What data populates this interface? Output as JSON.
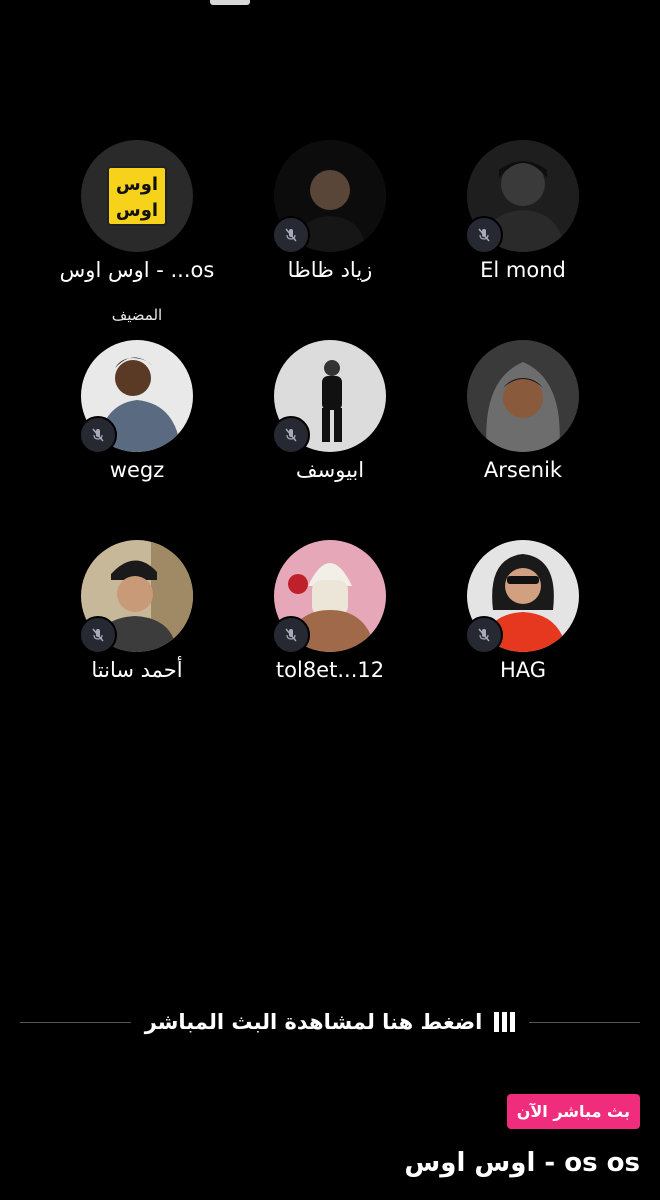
{
  "participants": [
    {
      "name": "اوس اوس - ...os",
      "role": "المضيف",
      "muted": false,
      "avatar": "logo-avatar"
    },
    {
      "name": "زياد ظاظا",
      "muted": true,
      "avatar": "person-avatar"
    },
    {
      "name": "El mond",
      "muted": true,
      "avatar": "person-avatar"
    },
    {
      "name": "wegz",
      "muted": true,
      "avatar": "person-avatar"
    },
    {
      "name": "ابيوسف",
      "muted": true,
      "avatar": "person-avatar"
    },
    {
      "name": "Arsenik",
      "muted": false,
      "avatar": "person-avatar"
    },
    {
      "name": "أحمد سانتا",
      "muted": true,
      "avatar": "person-avatar"
    },
    {
      "name": "tol8et...12",
      "muted": true,
      "avatar": "person-avatar"
    },
    {
      "name": "HAG",
      "muted": true,
      "avatar": "person-avatar"
    }
  ],
  "logo": {
    "line1": "اوس",
    "line2": "اوس"
  },
  "watch_prompt": "اضغط هنا لمشاهدة البث المباشر",
  "live_badge": "بث مباشر الآن",
  "live_title": "اوس اوس - os os",
  "icons": {
    "mute": "mic-off-icon",
    "watch": "audio-bars-icon"
  },
  "colors": {
    "background": "#000000",
    "live_badge": "#ef2d7c",
    "mute_badge": "#262932"
  }
}
